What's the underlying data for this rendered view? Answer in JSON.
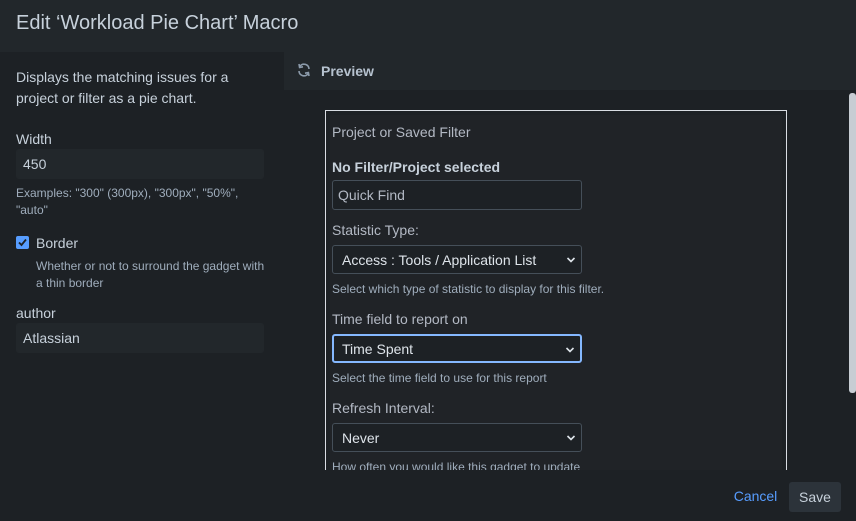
{
  "dialog": {
    "title": "Edit ‘Workload Pie Chart’ Macro"
  },
  "left": {
    "description": "Displays the matching issues for a project or filter as a pie chart.",
    "width_label": "Width",
    "width_value": "450",
    "width_help": "Examples: \"300\" (300px), \"300px\", \"50%\", \"auto\"",
    "border_label": "Border",
    "border_checked": true,
    "border_help": "Whether or not to surround the gadget with a thin border",
    "author_label": "author",
    "author_value": "Atlassian"
  },
  "preview": {
    "title": "Preview",
    "gadget": {
      "filter_label": "Project or Saved Filter",
      "no_filter": "No Filter/Project selected",
      "quick_find_placeholder": "Quick Find",
      "statistic_label": "Statistic Type:",
      "statistic_value": "Access : Tools / Application List",
      "statistic_help": "Select which type of statistic to display for this filter.",
      "time_field_label": "Time field to report on",
      "time_field_value": "Time Spent",
      "time_field_help": "Select the time field to use for this report",
      "refresh_label": "Refresh Interval:",
      "refresh_value": "Never",
      "refresh_help": "How often you would like this gadget to update"
    }
  },
  "footer": {
    "cancel_label": "Cancel",
    "save_label": "Save"
  },
  "colors": {
    "accent": "#579dff",
    "focus": "#85b8ff",
    "background": "#1d2125",
    "panel": "#22272b"
  }
}
